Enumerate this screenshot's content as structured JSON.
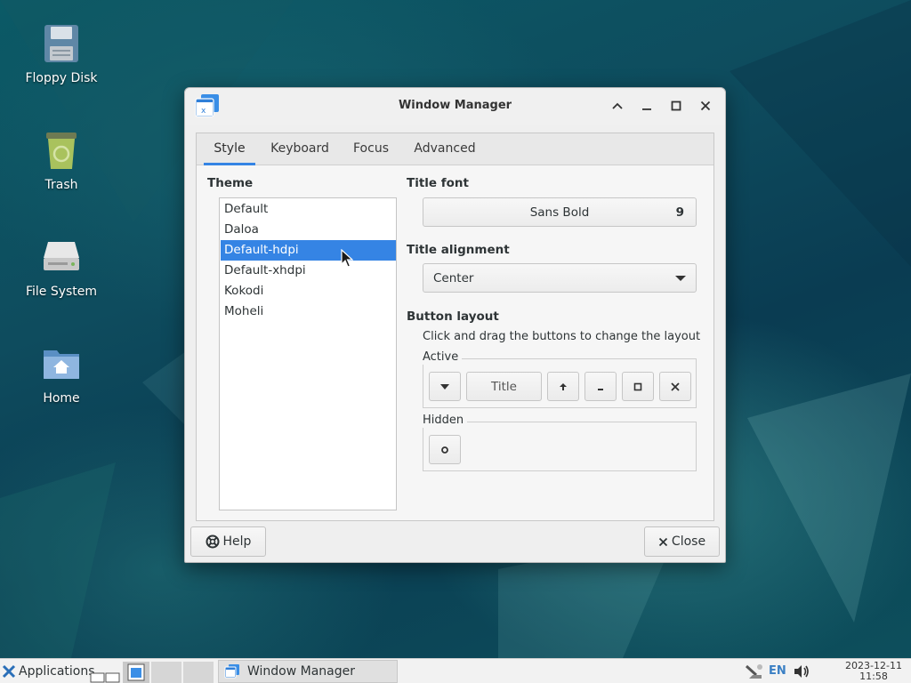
{
  "desktop": {
    "icons": [
      {
        "label": "Floppy Disk",
        "icon": "floppy-disk-icon"
      },
      {
        "label": "Trash",
        "icon": "trash-icon"
      },
      {
        "label": "File System",
        "icon": "hard-drive-icon"
      },
      {
        "label": "Home",
        "icon": "home-folder-icon"
      }
    ]
  },
  "window": {
    "title": "Window Manager",
    "tabs": [
      {
        "label": "Style",
        "active": true
      },
      {
        "label": "Keyboard"
      },
      {
        "label": "Focus"
      },
      {
        "label": "Advanced"
      }
    ],
    "theme": {
      "label": "Theme",
      "items": [
        "Default",
        "Daloa",
        "Default-hdpi",
        "Default-xhdpi",
        "Kokodi",
        "Moheli"
      ],
      "selected": "Default-hdpi"
    },
    "title_font": {
      "label": "Title font",
      "name": "Sans Bold",
      "size": "9"
    },
    "title_alignment": {
      "label": "Title alignment",
      "value": "Center"
    },
    "button_layout": {
      "label": "Button layout",
      "hint": "Click and drag the buttons to change the layout",
      "active_label": "Active",
      "hidden_label": "Hidden",
      "title_button": "Title"
    },
    "footer": {
      "help_label": "Help",
      "close_label": "Close"
    }
  },
  "taskbar": {
    "applications_label": "Applications",
    "window_label": "Window Manager",
    "keyboard_layout": "EN",
    "date": "2023-12-11",
    "time": "11:58"
  },
  "colors": {
    "accent": "#3584e4",
    "desktop": "#0e4d5c"
  }
}
